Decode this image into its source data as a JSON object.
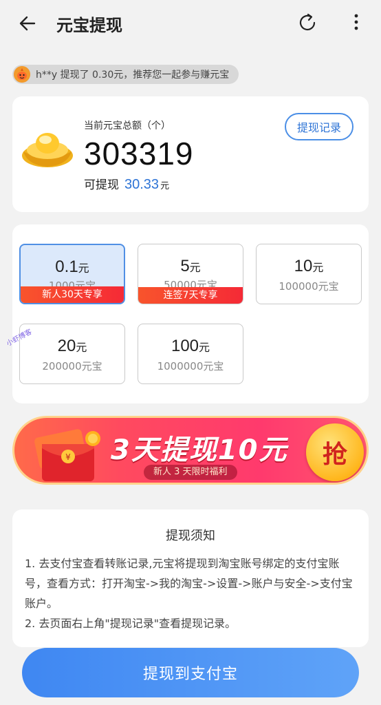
{
  "header": {
    "title": "元宝提现",
    "back_icon": "arrow-left-icon",
    "refresh_icon": "refresh-icon",
    "more_icon": "more-vertical-icon"
  },
  "ticker": {
    "text": "h**y 提现了 0.30元，推荐您一起参与赚元宝"
  },
  "balance": {
    "label": "当前元宝总额（个）",
    "total": "303319",
    "withdrawable_label": "可提现",
    "withdrawable_amount": "30.33",
    "withdrawable_unit": "元",
    "records_button": "提现记录"
  },
  "options": [
    {
      "amount": "0.1",
      "unit": "元",
      "ingots": "1000元宝",
      "tag": "新人30天专享",
      "selected": true
    },
    {
      "amount": "5",
      "unit": "元",
      "ingots": "50000元宝",
      "tag": "连签7天专享",
      "selected": false
    },
    {
      "amount": "10",
      "unit": "元",
      "ingots": "100000元宝",
      "tag": "",
      "selected": false
    },
    {
      "amount": "20",
      "unit": "元",
      "ingots": "200000元宝",
      "tag": "",
      "selected": false
    },
    {
      "amount": "100",
      "unit": "元",
      "ingots": "1000000元宝",
      "tag": "",
      "selected": false
    }
  ],
  "watermark": "小虾博客",
  "promo": {
    "title": "3天提现10元",
    "subtitle": "新人 3 天限时福利",
    "button": "抢"
  },
  "notice": {
    "title": "提现须知",
    "lines": [
      "1. 去支付宝查看转账记录,元宝将提现到淘宝账号绑定的支付宝账号，查看方式：打开淘宝->我的淘宝->设置->账户与安全->支付宝账户。",
      "2. 去页面右上角\"提现记录\"查看提现记录。"
    ]
  },
  "cta": {
    "label": "提现到支付宝"
  },
  "colors": {
    "accent_blue": "#2e74d6",
    "tag_red": "#f52a36",
    "cta_blue": "#3f87f2"
  }
}
